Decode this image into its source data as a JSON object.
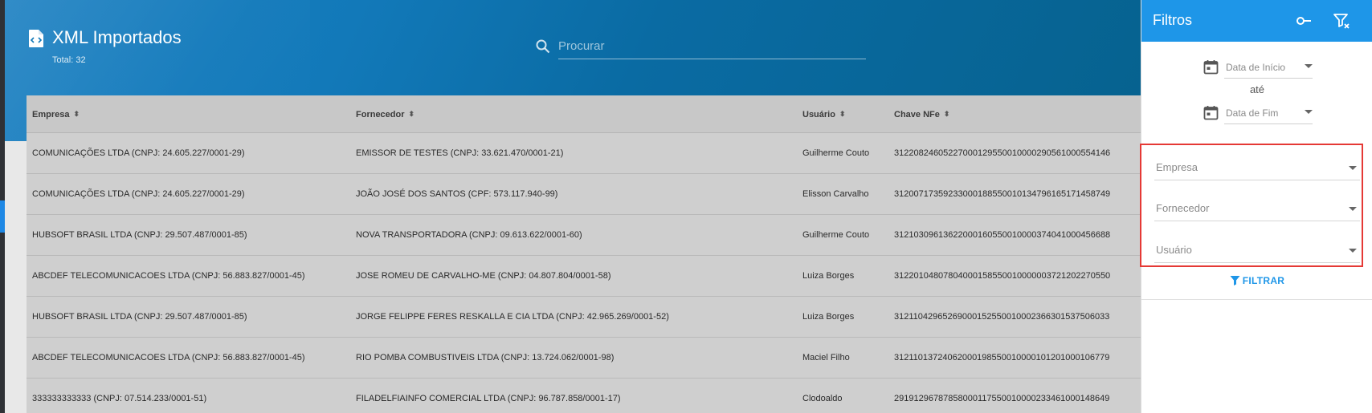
{
  "header": {
    "title": "XML Importados",
    "total": "Total: 32",
    "search_placeholder": "Procurar"
  },
  "table": {
    "columns": [
      "Empresa",
      "Fornecedor",
      "Usuário",
      "Chave NFe"
    ],
    "rows": [
      [
        "COMUNICAÇÕES LTDA (CNPJ: 24.605.227/0001-29)",
        "EMISSOR DE TESTES (CNPJ: 33.621.470/0001-21)",
        "Guilherme Couto",
        "31220824605227000129550010000290561000554146"
      ],
      [
        "COMUNICAÇÕES LTDA (CNPJ: 24.605.227/0001-29)",
        "JOÃO JOSÉ DOS SANTOS (CPF: 573.117.940-99)",
        "Elisson Carvalho",
        "31200717359233000188550010134796165171458749"
      ],
      [
        "HUBSOFT BRASIL LTDA (CNPJ: 29.507.487/0001-85)",
        "NOVA TRANSPORTADORA (CNPJ: 09.613.622/0001-60)",
        "Guilherme Couto",
        "31210309613622000160550010000374041000456688"
      ],
      [
        "ABCDEF TELECOMUNICACOES LTDA (CNPJ: 56.883.827/0001-45)",
        "JOSE ROMEU DE CARVALHO-ME (CNPJ: 04.807.804/0001-58)",
        "Luiza Borges",
        "31220104807804000158550010000003721202270550"
      ],
      [
        "HUBSOFT BRASIL LTDA (CNPJ: 29.507.487/0001-85)",
        "JORGE FELIPPE FERES RESKALLA E CIA LTDA (CNPJ: 42.965.269/0001-52)",
        "Luiza Borges",
        "31211042965269000152550010002366301537506033"
      ],
      [
        "ABCDEF TELECOMUNICACOES LTDA (CNPJ: 56.883.827/0001-45)",
        "RIO POMBA COMBUSTIVEIS LTDA (CNPJ: 13.724.062/0001-98)",
        "Maciel Filho",
        "31211013724062000198550010000101201000106779"
      ],
      [
        "333333333333 (CNPJ: 07.514.233/0001-51)",
        "FILADELFIAINFO COMERCIAL LTDA (CNPJ: 96.787.858/0001-17)",
        "Clodoaldo",
        "29191296787858000117550010000233461000148649"
      ]
    ]
  },
  "filters": {
    "title": "Filtros",
    "date_start": "Data de Início",
    "until": "até",
    "date_end": "Data de Fim",
    "empresa": "Empresa",
    "fornecedor": "Fornecedor",
    "usuario": "Usuário",
    "apply": "FILTRAR"
  },
  "icons": {
    "page": "xml-file-icon",
    "search": "search-icon",
    "key": "key-icon",
    "clear_filter": "filter-clear-icon",
    "calendar": "calendar-icon",
    "filter": "filter-icon"
  },
  "colors": {
    "header_blue": "#1279b9",
    "panel_blue": "#1e96e8",
    "highlight_red": "#e53935"
  }
}
